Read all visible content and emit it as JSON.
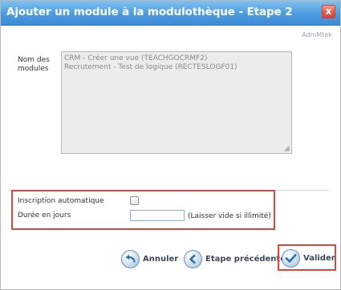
{
  "dialog": {
    "title": "Ajouter un module à la modulothèque - Etape 2",
    "close_glyph": "x",
    "subtitle": "AdmMtek"
  },
  "form": {
    "modules_label_line1": "Nom des",
    "modules_label_line2": "modules",
    "modules": [
      "CRM - Créer une vue (TEACHGOCRMF2)",
      "Recrutement - Test de logique (RECTESLOGF01)"
    ],
    "auto_label": "Inscription automatique",
    "auto_checked": false,
    "duration_label": "Durée en jours",
    "duration_value": "",
    "duration_hint": "(Laisser vide si illimité)"
  },
  "buttons": {
    "cancel": "Annuler",
    "previous": "Etape précédente",
    "validate": "Valider"
  },
  "colors": {
    "titlebar": "#4c9be0",
    "highlight": "#d9463d",
    "close": "#e2574a"
  },
  "icons": {
    "cancel": "undo-arrow-icon",
    "previous": "arrow-left-icon",
    "validate": "checkmark-icon",
    "close": "close-icon",
    "resize": "resize-grip-icon"
  }
}
